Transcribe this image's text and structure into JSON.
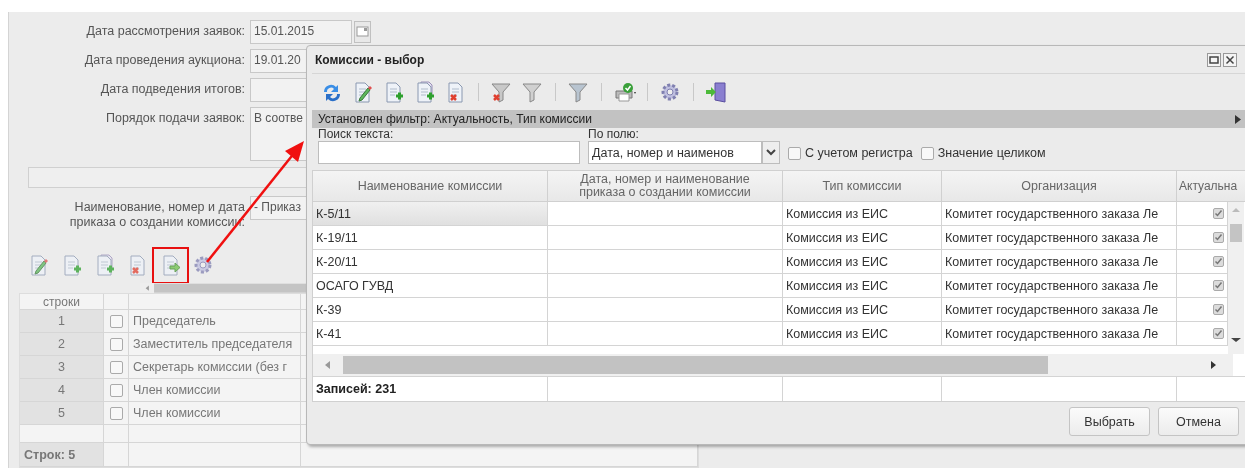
{
  "form": {
    "fields": [
      {
        "kind": "date",
        "label": "Дата рассмотрения заявок:",
        "value": "15.01.2015"
      },
      {
        "kind": "text",
        "label": "Дата проведения аукциона:",
        "value": "19.01.20"
      },
      {
        "kind": "text",
        "label": "Дата подведения итогов:"
      },
      {
        "kind": "textarea",
        "label": "Порядок подачи заявок:",
        "value": "В соотве"
      },
      {
        "kind": "blank"
      },
      {
        "kind": "text",
        "label": "Наименование, номер и дата приказа о создании комиссии:",
        "value": "- Приказ"
      }
    ]
  },
  "members": {
    "toolbar": [
      {
        "kind": "edit",
        "highlighted": false
      },
      {
        "kind": "add",
        "highlighted": false
      },
      {
        "kind": "copy",
        "highlighted": false
      },
      {
        "kind": "delete",
        "highlighted": false
      },
      {
        "kind": "export",
        "highlighted": true
      },
      {
        "kind": "settings",
        "highlighted": false
      }
    ],
    "table": {
      "header": "строки",
      "rows": [
        {
          "number": "1",
          "checked": false,
          "role": "Председатель"
        },
        {
          "number": "2",
          "checked": false,
          "role": "Заместитель председателя"
        },
        {
          "number": "3",
          "checked": false,
          "role": "Секретарь комиссии (без г"
        },
        {
          "number": "4",
          "checked": false,
          "role": "Член комиссии"
        },
        {
          "number": "5",
          "checked": false,
          "role": "Член комиссии"
        }
      ],
      "footer": "Строк: 5"
    }
  },
  "dialog": {
    "title": "Комиссии - выбор",
    "toolbar": [
      [
        {
          "kind": "refresh"
        },
        {
          "kind": "edit"
        },
        {
          "kind": "add"
        },
        {
          "kind": "copy"
        },
        {
          "kind": "delete"
        }
      ],
      [
        {
          "kind": "filter-clear"
        },
        {
          "kind": "filter-off"
        }
      ],
      [
        {
          "kind": "filter"
        }
      ],
      [
        {
          "kind": "print"
        }
      ],
      [
        {
          "kind": "settings"
        }
      ],
      [
        {
          "kind": "exit"
        }
      ]
    ],
    "filter_text": "Установлен фильтр: Актуальность, Тип комиссии",
    "search": {
      "label": "Поиск текста:"
    },
    "field": {
      "label": "По полю:",
      "value": "Дата, номер и наименов"
    },
    "options": [
      {
        "label": "С учетом регистра",
        "checked": false
      },
      {
        "label": "Значение целиком",
        "checked": false
      }
    ],
    "columns": [
      "Наименование комиссии",
      "Дата, номер и наименование приказа о создании комиссии",
      "Тип комиссии",
      "Организация",
      "Актуальна"
    ],
    "rows": [
      {
        "name": "К-5/11",
        "type": "Комиссия из ЕИС",
        "organization": "Комитет государственного заказа Ле",
        "actual": true,
        "selected": true
      },
      {
        "name": "К-19/11",
        "type": "Комиссия из ЕИС",
        "organization": "Комитет государственного заказа Ле",
        "actual": true,
        "selected": false
      },
      {
        "name": "К-20/11",
        "type": "Комиссия из ЕИС",
        "organization": "Комитет государственного заказа Ле",
        "actual": true,
        "selected": false
      },
      {
        "name": "ОСАГО ГУВД",
        "type": "Комиссия из ЕИС",
        "organization": "Комитет государственного заказа Ле",
        "actual": true,
        "selected": false
      },
      {
        "name": "К-39",
        "type": "Комиссия из ЕИС",
        "organization": "Комитет государственного заказа Ле",
        "actual": true,
        "selected": false
      },
      {
        "name": "К-41",
        "type": "Комиссия из ЕИС",
        "organization": "Комитет государственного заказа Ле",
        "actual": true,
        "selected": false
      }
    ],
    "records": "Записей: 231",
    "buttons": [
      "Выбрать",
      "Отмена"
    ]
  }
}
